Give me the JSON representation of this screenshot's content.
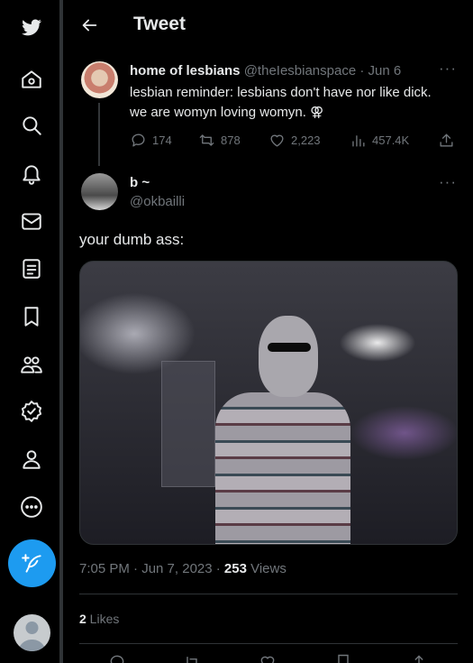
{
  "nav": {
    "items": [
      {
        "name": "twitter-logo-icon"
      },
      {
        "name": "home-icon"
      },
      {
        "name": "explore-icon"
      },
      {
        "name": "notifications-icon"
      },
      {
        "name": "messages-icon"
      },
      {
        "name": "lists-icon"
      },
      {
        "name": "bookmarks-icon"
      },
      {
        "name": "communities-icon"
      },
      {
        "name": "verified-icon"
      },
      {
        "name": "profile-icon"
      },
      {
        "name": "more-icon"
      }
    ],
    "compose_icon": "compose-icon",
    "accent": "#1d9bf0"
  },
  "header": {
    "title": "Tweet"
  },
  "parent_tweet": {
    "display_name": "home of lesbians",
    "handle": "@theIesbianspace",
    "separator": "·",
    "date": "Jun 6",
    "more": "···",
    "text_line1": "lesbian reminder: lesbians don't have nor like dick.",
    "text_line2": "we are womyn loving womyn. ⚢",
    "replies": "174",
    "retweets": "878",
    "likes": "2,223",
    "views": "457.4K"
  },
  "tweet": {
    "display_name": "b ~",
    "handle": "@okbailli",
    "more": "···",
    "text": "your dumb ass:",
    "time": "7:05 PM · Jun 7, 2023 · ",
    "views_count": "253",
    "views_label": " Views",
    "likes_count": "2",
    "likes_label": " Likes"
  }
}
